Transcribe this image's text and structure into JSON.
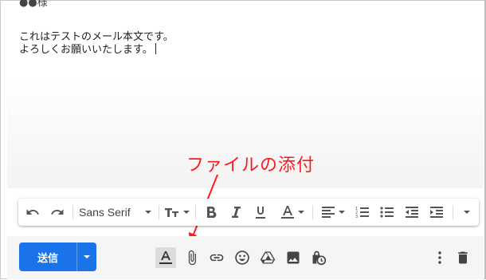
{
  "body": {
    "line0": "●●様",
    "line1": "これはテストのメール本文です。",
    "line2": "よろしくお願いいたします。"
  },
  "annotation": {
    "text": "ファイルの添付",
    "color": "#ff1a1a"
  },
  "format_toolbar": {
    "font": "Sans Serif",
    "icons": [
      "undo-icon",
      "redo-icon",
      "font-size-icon",
      "bold-icon",
      "italic-icon",
      "underline-icon",
      "text-color-icon",
      "align-icon",
      "numbered-list-icon",
      "bulleted-list-icon",
      "indent-less-icon",
      "indent-more-icon",
      "more-formatting-icon"
    ]
  },
  "compose_toolbar": {
    "send_label": "送信",
    "accent": "#1a73e8",
    "icons": [
      "formatting-options-icon",
      "attach-file-icon",
      "insert-link-icon",
      "emoji-icon",
      "drive-icon",
      "insert-photo-icon",
      "confidential-mode-icon",
      "more-options-icon",
      "discard-icon"
    ]
  }
}
